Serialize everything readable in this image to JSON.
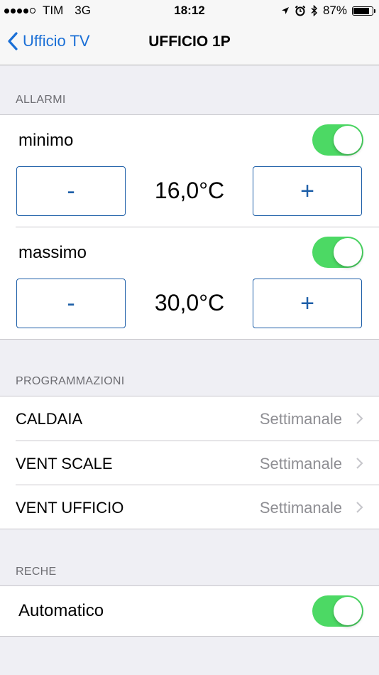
{
  "status_bar": {
    "carrier": "TIM",
    "network": "3G",
    "time": "18:12",
    "battery": "87%",
    "battery_level": 0.87
  },
  "nav": {
    "back_label": "Ufficio TV",
    "title": "UFFICIO 1P"
  },
  "allarmi": {
    "header": "ALLARMI",
    "minimo": {
      "label": "minimo",
      "enabled": true,
      "minus_label": "-",
      "plus_label": "+",
      "value": "16,0°C"
    },
    "massimo": {
      "label": "massimo",
      "enabled": true,
      "minus_label": "-",
      "plus_label": "+",
      "value": "30,0°C"
    }
  },
  "programmazioni": {
    "header": "PROGRAMMAZIONI",
    "rows": [
      {
        "label": "CALDAIA",
        "value": "Settimanale"
      },
      {
        "label": "VENT SCALE",
        "value": "Settimanale"
      },
      {
        "label": "VENT UFFICIO",
        "value": "Settimanale"
      }
    ]
  },
  "reche": {
    "header": "RECHE",
    "automatico": {
      "label": "Automatico",
      "enabled": true
    }
  },
  "colors": {
    "accent": "#1a6fd6",
    "toggle_on": "#4cd964",
    "secondary_text": "#8e8e93"
  }
}
